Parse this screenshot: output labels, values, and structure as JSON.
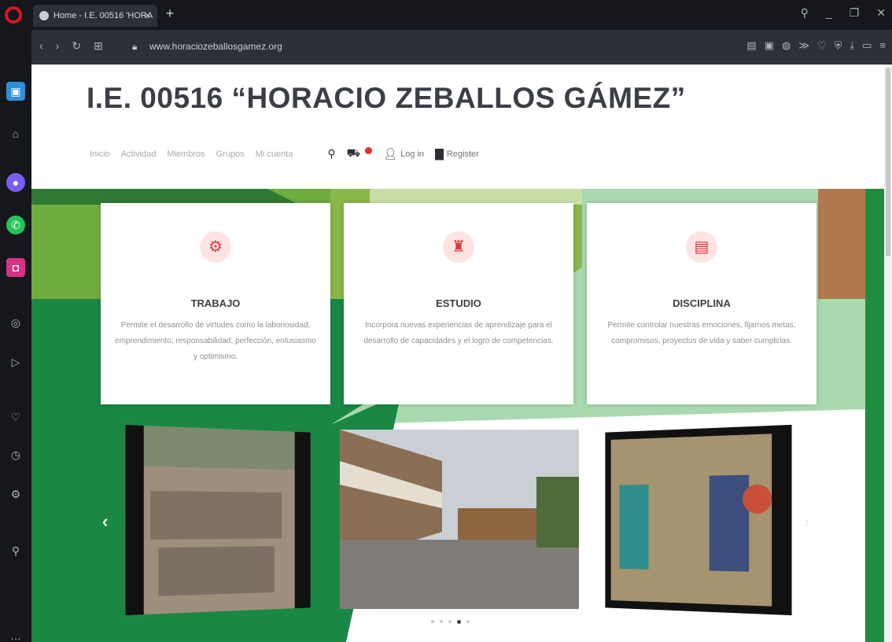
{
  "browser": {
    "tab_title": "Home - I.E. 00516 'HORA",
    "url": "www.horaciozeballosgamez.org"
  },
  "site": {
    "title": "I.E. 00516 “HORACIO ZEBALLOS GÁMEZ”",
    "nav": [
      "Inicio",
      "Actividad",
      "Miembros",
      "Grupos",
      "Mi cuenta"
    ],
    "login_label": "Log in",
    "register_label": "Register"
  },
  "cards": [
    {
      "icon": "tractor-icon",
      "title": "TRABAJO",
      "text": "Permite el desarrollo de virtudes como la laboriosidad, emprendimiento, responsabilidad, perfección, entusiasmo y optimismo."
    },
    {
      "icon": "graduate-icon",
      "title": "ESTUDIO",
      "text": "Incorpora nuevas experiencias de aprendizaje para el desarrollo de capacidades y el logro de competencias."
    },
    {
      "icon": "id-card-icon",
      "title": "DISCIPLINA",
      "text": "Permite controlar nuestras emociones, fijarnos metas, compromisos, proyectos de vida y saber cumplirlas."
    }
  ],
  "carousel": {
    "dot_count": 5,
    "active_dot": 3
  },
  "colors": {
    "accent": "#e2373a",
    "hero_green": "#1a8844",
    "light_green": "#a9d9ae",
    "brown": "#b07a4e"
  }
}
